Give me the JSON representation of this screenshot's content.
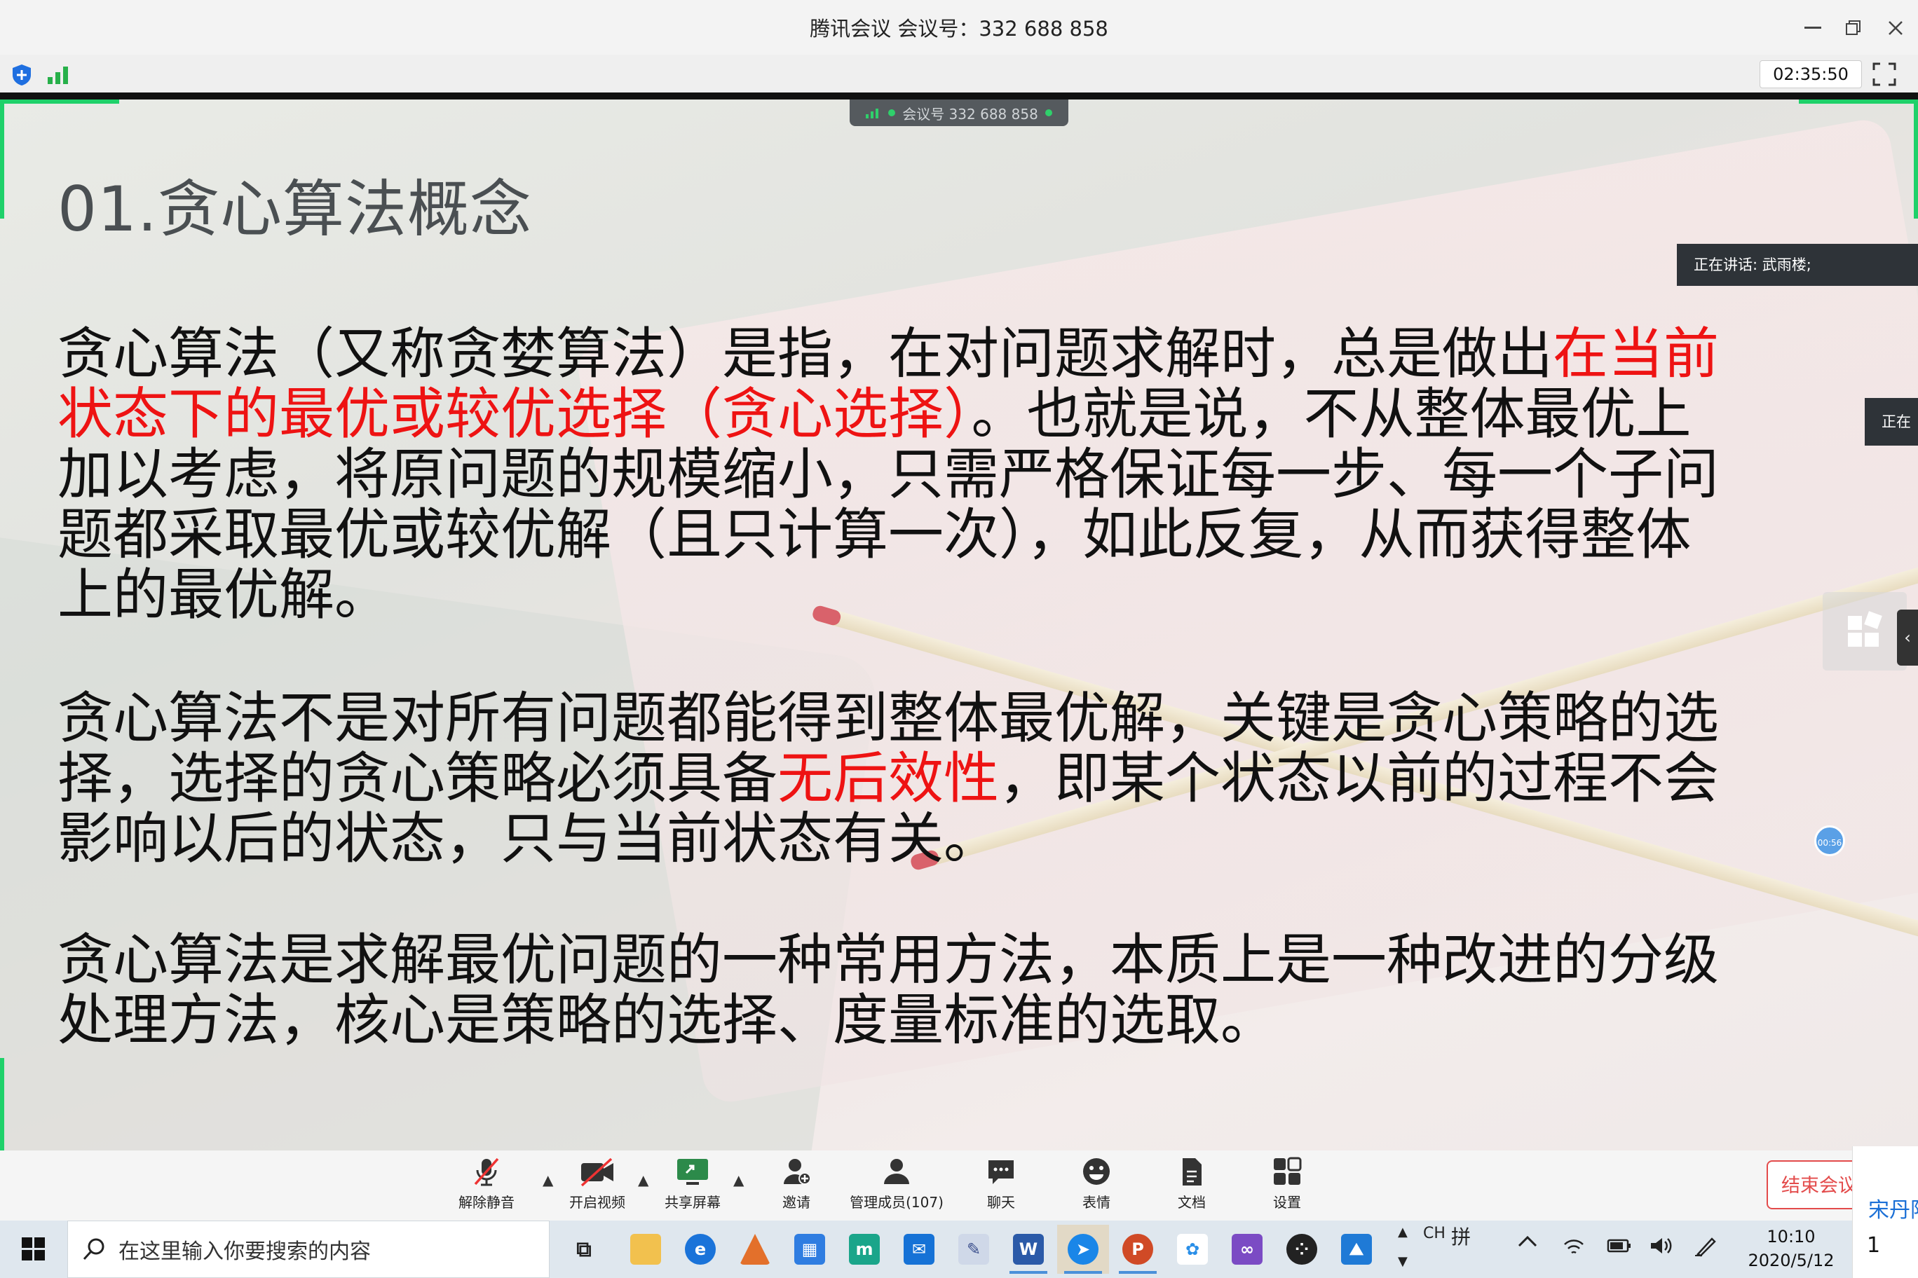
{
  "window": {
    "title": "腾讯会议 会议号：332 688 858",
    "minimize_icon": "minimize-icon",
    "restore_icon": "restore-icon",
    "close_icon": "close-icon"
  },
  "status_bar": {
    "timer": "02:35:50"
  },
  "meeting_chip": {
    "text": "会议号 332 688 858"
  },
  "slide": {
    "title": "01.贪心算法概念",
    "p1": [
      {
        "t": "贪心算法（又称贪婪算法）是指，在对问题求解时，总是做出",
        "red": false
      },
      {
        "t": "在当前状态下的最优或较优选择（贪心选择）",
        "red": true
      },
      {
        "t": "。也就是说，不从整体最优上加以考虑，将原问题的规模缩小，只需严格保证每一步、每一个子问题都采取最优或较优解（且只计算一次），如此反复，从而获得整体上的最优解。",
        "red": false
      }
    ],
    "p2": [
      {
        "t": "贪心算法不是对所有问题都能得到整体最优解，关键是贪心策略的选择，选择的贪心策略必须具备",
        "red": false
      },
      {
        "t": "无后效性",
        "red": true
      },
      {
        "t": "，即某个状态以前的过程不会影响以后的状态，只与当前状态有关。",
        "red": false
      }
    ],
    "p3": "贪心算法是求解最优问题的一种常用方法，本质上是一种改进的分级处理方法，核心是策略的选择、度量标准的选取。"
  },
  "overlay": {
    "speaking_label": "正在讲话: 武雨楼;",
    "speaking_label2": "正在",
    "bubble": "00:56"
  },
  "controls": {
    "mute": "解除静音",
    "video": "开启视频",
    "share": "共享屏幕",
    "invite": "邀请",
    "members": "管理成员(107)",
    "chat": "聊天",
    "emoji": "表情",
    "docs": "文档",
    "settings": "设置",
    "end": "结束会议"
  },
  "taskbar": {
    "search_placeholder": "在这里输入你要搜索的内容",
    "ime_lang": "CH",
    "ime_mode": "拼",
    "time": "10:10",
    "date": "2020/5/12",
    "notif_name": "宋丹阳",
    "notif_count": "1"
  },
  "colors": {
    "accent_green": "#1fd16a",
    "slide_red": "#ee1313",
    "end_red": "#e34b4b"
  }
}
